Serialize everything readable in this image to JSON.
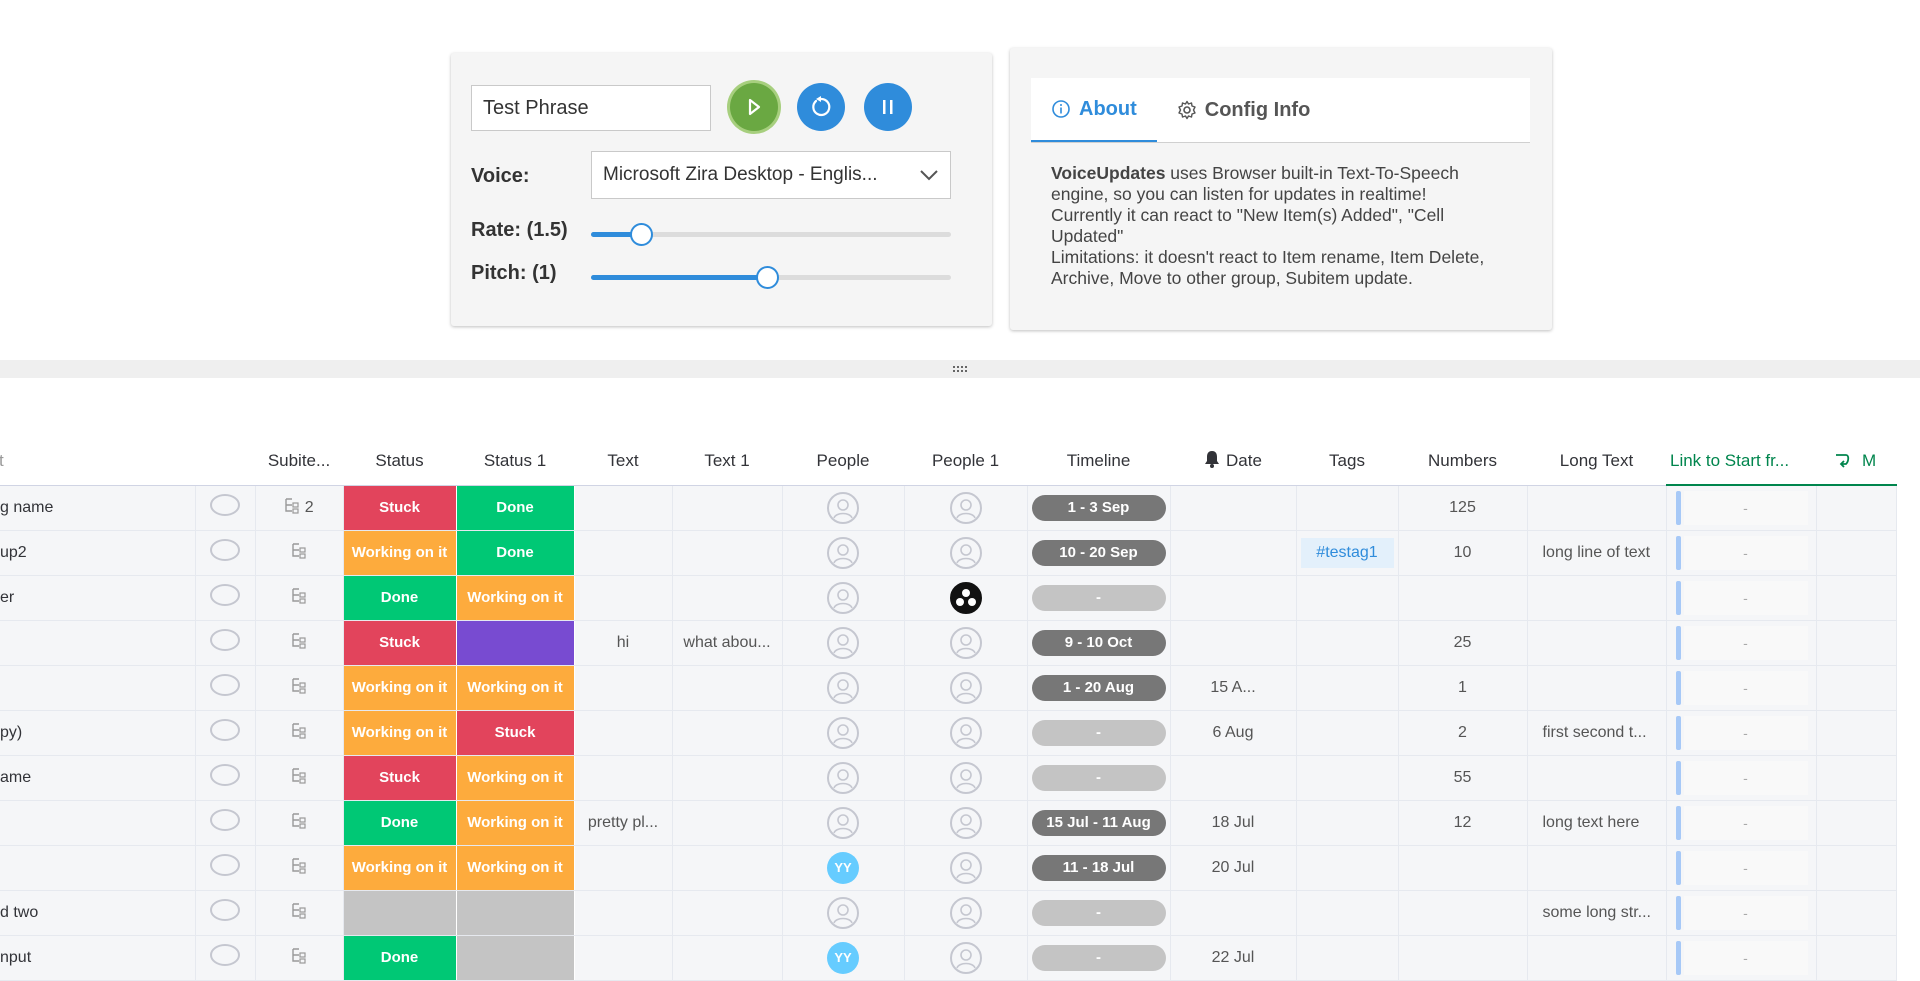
{
  "controls": {
    "phrase_value": "Test Phrase",
    "voice_label": "Voice:",
    "voice_value": "Microsoft Zira Desktop - Englis...",
    "rate_label": "Rate: (1.5)",
    "rate_fraction": 0.14,
    "pitch_label": "Pitch: (1)",
    "pitch_fraction": 0.49,
    "play_icon": "play-icon",
    "reset_icon": "restart-icon",
    "pause_icon": "pause-icon",
    "accent_color": "#2f8cdb",
    "play_color": "#6aa842"
  },
  "about": {
    "tabs": [
      {
        "label": "About",
        "icon": "info-icon",
        "active": true
      },
      {
        "label": "Config Info",
        "icon": "gear-icon",
        "active": false
      }
    ],
    "bold_lead": "VoiceUpdates",
    "line1": " uses Browser built-in Text-To-Speech engine, so you can listen for updates in realtime!",
    "line2": "Currently it can react to \"New Item(s) Added\", \"Cell Updated\"",
    "line3": "Limitations: it doesn't react to Item rename, Item Delete, Archive, Move to other group, Subitem update."
  },
  "board": {
    "columns": {
      "name": "t",
      "subitems": "Subite...",
      "status": "Status",
      "status1": "Status 1",
      "text": "Text",
      "text1": "Text 1",
      "people": "People",
      "people1": "People 1",
      "timeline": "Timeline",
      "date": "Date",
      "tags": "Tags",
      "numbers": "Numbers",
      "longtext": "Long Text",
      "link": "Link to Start fr...",
      "mirror": "M"
    },
    "status_colors": {
      "Stuck": "#e2445c",
      "Done": "#00c875",
      "Working on it": "#fdab3d",
      "purple": "#784bd1",
      "empty": "#c4c4c4"
    },
    "rows": [
      {
        "name": "g name",
        "sub": "2",
        "status": "Stuck",
        "status1": "Done",
        "text": "",
        "text1": "",
        "people": "",
        "people1": "",
        "timeline": "1 - 3 Sep",
        "date": "",
        "tags": "",
        "numbers": "125",
        "longtext": "",
        "link": "-"
      },
      {
        "name": "up2",
        "sub": "",
        "status": "Working on it",
        "status1": "Done",
        "text": "",
        "text1": "",
        "people": "",
        "people1": "",
        "timeline": "10 - 20 Sep",
        "date": "",
        "tags": "#testag1",
        "numbers": "10",
        "longtext": "long line of text",
        "link": "-"
      },
      {
        "name": "er",
        "sub": "",
        "status": "Done",
        "status1": "Working on it",
        "text": "",
        "text1": "",
        "people": "",
        "people1": "blk",
        "timeline": "-",
        "date": "",
        "tags": "",
        "numbers": "",
        "longtext": "",
        "link": "-"
      },
      {
        "name": "",
        "sub": "",
        "status": "Stuck",
        "status1": "purple",
        "text": "hi",
        "text1": "what abou...",
        "people": "",
        "people1": "",
        "timeline": "9 - 10 Oct",
        "date": "",
        "tags": "",
        "numbers": "25",
        "longtext": "",
        "link": "-"
      },
      {
        "name": "",
        "sub": "",
        "status": "Working on it",
        "status1": "Working on it",
        "text": "",
        "text1": "",
        "people": "",
        "people1": "",
        "timeline": "1 - 20 Aug",
        "date": "15 A...",
        "tags": "",
        "numbers": "1",
        "longtext": "",
        "link": "-"
      },
      {
        "name": "py)",
        "sub": "",
        "status": "Working on it",
        "status1": "Stuck",
        "text": "",
        "text1": "",
        "people": "",
        "people1": "",
        "timeline": "-",
        "date": "6 Aug",
        "tags": "",
        "numbers": "2",
        "longtext": "first second t...",
        "link": "-"
      },
      {
        "name": "ame",
        "sub": "",
        "status": "Stuck",
        "status1": "Working on it",
        "text": "",
        "text1": "",
        "people": "",
        "people1": "",
        "timeline": "-",
        "date": "",
        "tags": "",
        "numbers": "55",
        "longtext": "",
        "link": "-"
      },
      {
        "name": "",
        "sub": "",
        "status": "Done",
        "status1": "Working on it",
        "text": "pretty pl...",
        "text1": "",
        "people": "",
        "people1": "",
        "timeline": "15 Jul - 11 Aug",
        "date": "18 Jul",
        "tags": "",
        "numbers": "12",
        "longtext": "long text here",
        "link": "-"
      },
      {
        "name": "",
        "sub": "",
        "status": "Working on it",
        "status1": "Working on it",
        "text": "",
        "text1": "",
        "people": "YY",
        "people1": "",
        "timeline": "11 - 18 Jul",
        "date": "20 Jul",
        "tags": "",
        "numbers": "",
        "longtext": "",
        "link": "-"
      },
      {
        "name": "d two",
        "sub": "",
        "status": "empty",
        "status1": "empty",
        "text": "",
        "text1": "",
        "people": "",
        "people1": "",
        "timeline": "-",
        "date": "",
        "tags": "",
        "numbers": "",
        "longtext": "some long str...",
        "link": "-"
      },
      {
        "name": "nput",
        "sub": "",
        "status": "Done",
        "status1": "empty",
        "text": "",
        "text1": "",
        "people": "YY",
        "people1": "",
        "timeline": "-",
        "date": "22 Jul",
        "tags": "",
        "numbers": "",
        "longtext": "",
        "link": "-"
      }
    ]
  }
}
